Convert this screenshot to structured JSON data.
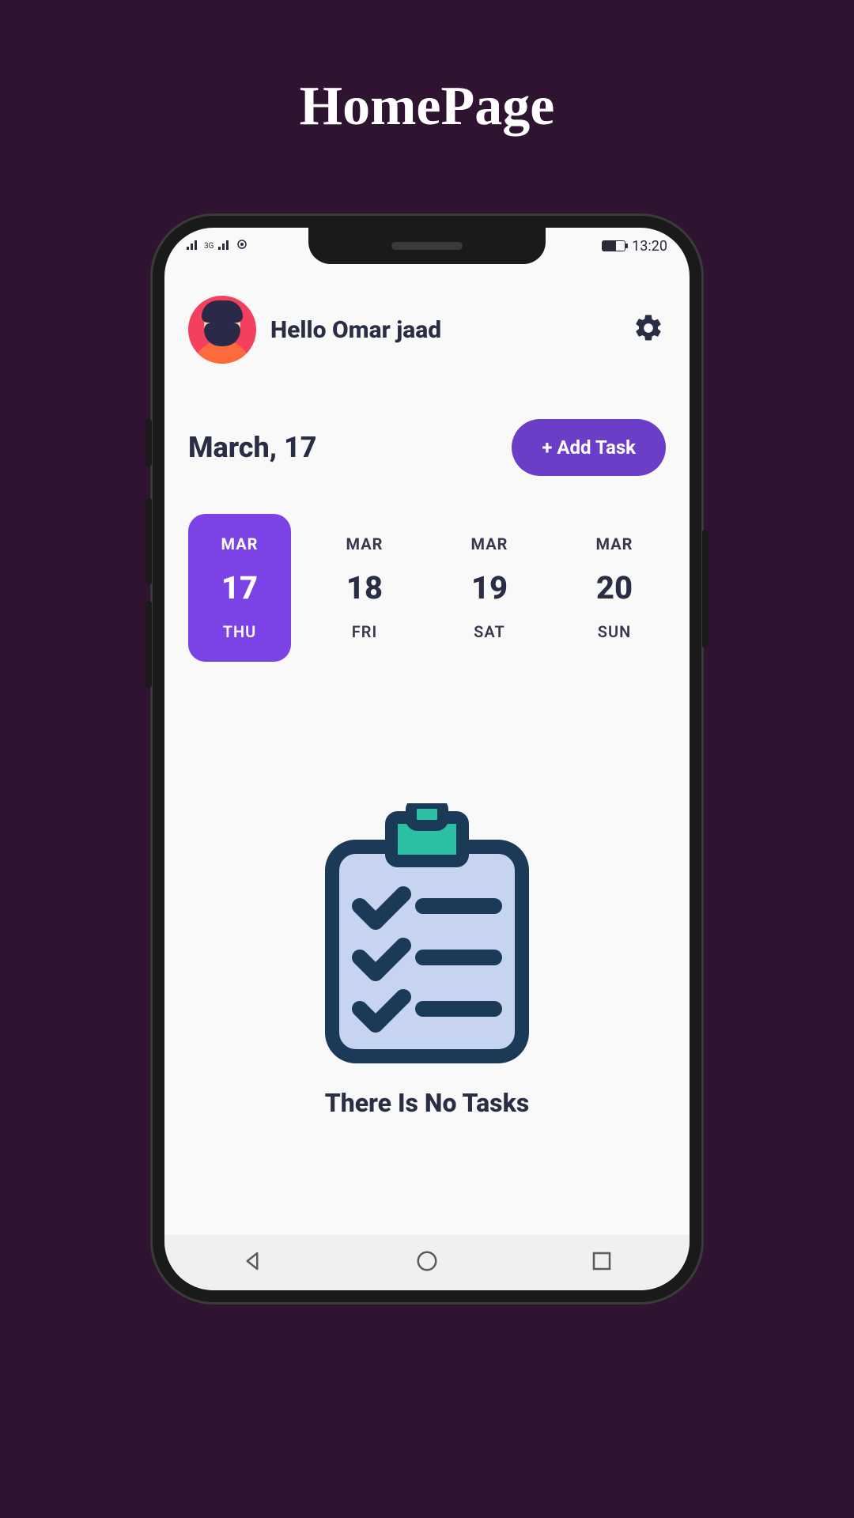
{
  "page": {
    "title": "HomePage"
  },
  "status": {
    "network": "3G",
    "time": "13:20"
  },
  "header": {
    "greeting": "Hello Omar jaad"
  },
  "date": {
    "label": "March, 17",
    "add_task": "+ Add Task"
  },
  "days": [
    {
      "month": "MAR",
      "day": "17",
      "weekday": "THU",
      "active": true
    },
    {
      "month": "MAR",
      "day": "18",
      "weekday": "FRI",
      "active": false
    },
    {
      "month": "MAR",
      "day": "19",
      "weekday": "SAT",
      "active": false
    },
    {
      "month": "MAR",
      "day": "20",
      "weekday": "SUN",
      "active": false
    }
  ],
  "empty": {
    "message": "There Is No Tasks"
  },
  "colors": {
    "accent": "#6b3ec7",
    "bg": "#2f1431",
    "text": "#2a2e45"
  }
}
